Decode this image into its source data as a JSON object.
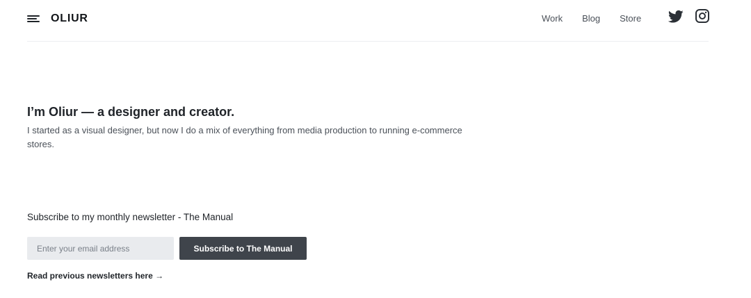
{
  "header": {
    "logo": "OLIUR",
    "menu_icon": "hamburger-menu-icon",
    "nav": [
      {
        "label": "Work"
      },
      {
        "label": "Blog"
      },
      {
        "label": "Store"
      }
    ],
    "social": [
      {
        "icon": "twitter-icon"
      },
      {
        "icon": "instagram-icon"
      }
    ]
  },
  "hero": {
    "title": "I’m Oliur — a designer and creator.",
    "text": "I started as a visual designer, but now I do a mix of everything from media production to running e-commerce stores."
  },
  "newsletter": {
    "heading": "Subscribe to my monthly newsletter - The Manual",
    "email_placeholder": "Enter your email address",
    "email_value": "",
    "button_label": "Subscribe to The Manual",
    "previous_link": "Read previous newsletters here →"
  },
  "colors": {
    "button_bg": "#3f444b",
    "input_bg": "#e9ebee",
    "text_primary": "#1f2328",
    "text_secondary": "#4a5058"
  }
}
